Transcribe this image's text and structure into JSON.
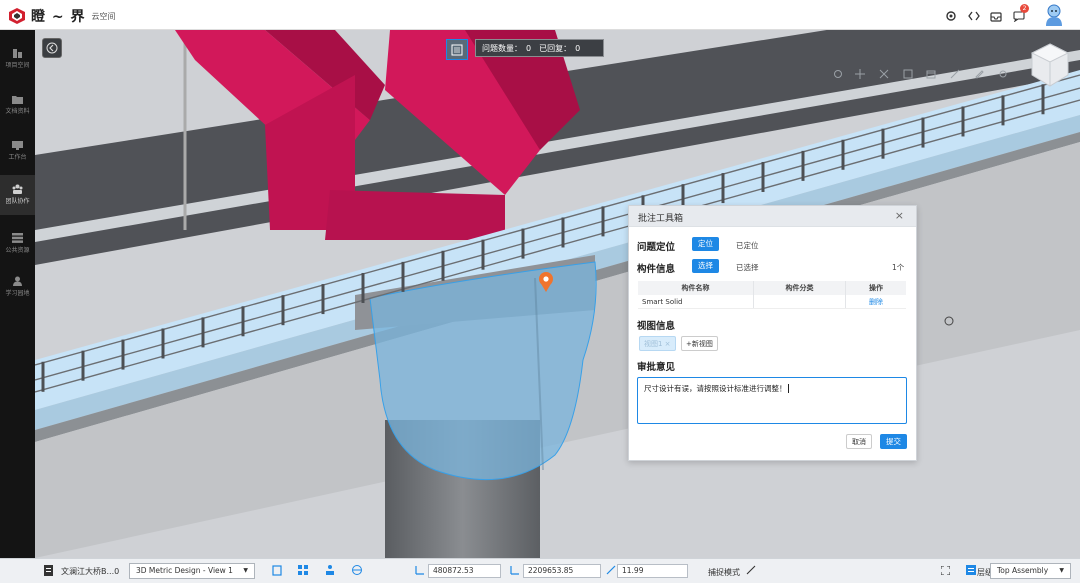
{
  "app": {
    "logo_text": "瞪 ~ 界",
    "logo_sub": "云空间",
    "notification_count": "2"
  },
  "sidebar": {
    "items": [
      {
        "label": "项目空间",
        "icon": "building-icon"
      },
      {
        "label": "文档资料",
        "icon": "folder-icon"
      },
      {
        "label": "工作台",
        "icon": "monitor-icon"
      },
      {
        "label": "团队协作",
        "icon": "team-icon",
        "active": true
      },
      {
        "label": "公共资源",
        "icon": "resources-icon"
      },
      {
        "label": "学习园地",
        "icon": "learn-icon"
      }
    ]
  },
  "viewport": {
    "issue_count_label": "问题数量：",
    "issue_count": "0",
    "replied_label": "已回复：",
    "replied_count": "0"
  },
  "annotation_panel": {
    "title": "批注工具箱",
    "location_label": "问题定位",
    "locate_button": "定位",
    "located_text": "已定位",
    "component_label": "构件信息",
    "select_button": "选择",
    "selected_text": "已选择",
    "selected_count": "1个",
    "table": {
      "headers": [
        "构件名称",
        "构件分类",
        "操作"
      ],
      "rows": [
        {
          "name": "Smart Solid",
          "category": "",
          "action": "删除"
        }
      ]
    },
    "view_label": "视图信息",
    "view_chip": "视图1 ×",
    "add_view_button": "+新视图",
    "review_label": "审批意见",
    "review_text": "尺寸设计有误，请按照设计标准进行调整！",
    "cancel_button": "取消",
    "submit_button": "提交"
  },
  "statusbar": {
    "file_name": "文澜江大桥B...0",
    "view_select": "3D Metric Design - View 1",
    "x_value": "480872.53",
    "y_value": "2209653.85",
    "z_value": "11.99",
    "snap_mode_label": "捕捉模式",
    "level_label": "层级:",
    "level_select": "Top Assembly"
  },
  "colors": {
    "accent": "#1e88e5",
    "girder": "#d2185a",
    "deck": "#c7e3f7",
    "pier": "#727578"
  }
}
